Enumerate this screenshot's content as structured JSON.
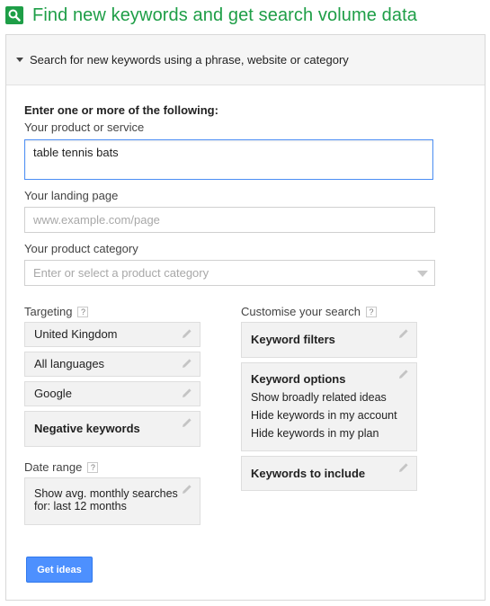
{
  "header": {
    "title": "Find new keywords and get search volume data",
    "icon": "search-icon"
  },
  "panel": {
    "title": "Search for new keywords using a phrase, website or category"
  },
  "form": {
    "intro": "Enter one or more of the following:",
    "product_label": "Your product or service",
    "product_value": "table tennis bats",
    "landing_label": "Your landing page",
    "landing_placeholder": "www.example.com/page",
    "category_label": "Your product category",
    "category_placeholder": "Enter or select a product category"
  },
  "targeting": {
    "label": "Targeting",
    "help": "?",
    "location": "United Kingdom",
    "language": "All languages",
    "network": "Google",
    "negative": "Negative keywords"
  },
  "date_range": {
    "label": "Date range",
    "help": "?",
    "line1": "Show avg. monthly searches",
    "line2": "for: last 12 months"
  },
  "customise": {
    "label": "Customise your search",
    "help": "?",
    "filters": "Keyword filters",
    "options_title": "Keyword options",
    "options": [
      "Show broadly related ideas",
      "Hide keywords in my account",
      "Hide keywords in my plan"
    ],
    "include": "Keywords to include"
  },
  "actions": {
    "get_ideas": "Get ideas"
  },
  "colors": {
    "brand_green": "#1e9e47",
    "button_blue": "#4d90fe",
    "focus_blue": "#4d8ff5"
  }
}
